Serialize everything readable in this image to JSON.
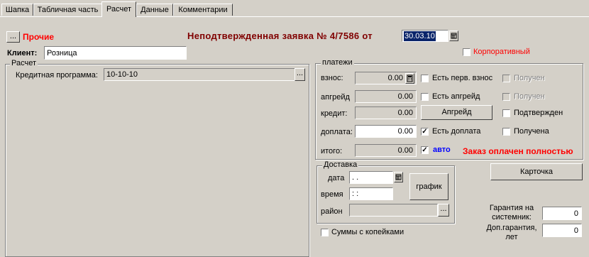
{
  "tabs": [
    "Шапка",
    "Табличная часть",
    "Расчет",
    "Данные",
    "Комментарии"
  ],
  "header": {
    "dots_label": "...",
    "other_label": "Прочие",
    "title": "Неподтвержденная заявка №  4/7586  от",
    "date_value": "30.03.10",
    "client_label": "Клиент:",
    "client_value": "Розница",
    "corporate_label": "Корпоративный"
  },
  "calc": {
    "group_title": "Расчет",
    "credit_label": "Кредитная программа:",
    "credit_value": "10-10-10",
    "ellipsis": "..."
  },
  "payments": {
    "group_title": "платежи",
    "rows": [
      {
        "label": "взнос:",
        "value": "0.00"
      },
      {
        "label": "апгрейд",
        "value": "0.00"
      },
      {
        "label": "кредит:",
        "value": "0.00"
      },
      {
        "label": "доплата:",
        "value": "0.00"
      },
      {
        "label": "итого:",
        "value": "0.00"
      }
    ],
    "first_payment_label": "Есть перв. взнос",
    "upgrade_label": "Есть апгрейд",
    "upgrade_button": "Апгрейд",
    "surcharge_label": "Есть доплата",
    "auto_label": "авто",
    "received1_label": "Получен",
    "received2_label": "Получен",
    "confirmed_label": "Подтвержден",
    "received3_label": "Получена",
    "paid_message": "Заказ оплачен полностью",
    "checks": {
      "first_payment": false,
      "upgrade": false,
      "surcharge": true,
      "auto": true,
      "received1": false,
      "received2": false,
      "confirmed": false,
      "received3": false
    }
  },
  "delivery": {
    "group_title": "Доставка",
    "date_label": "дата",
    "date_value": " .  .",
    "time_label": "время",
    "time_value": " :  :",
    "district_label": "район",
    "schedule_button": "график",
    "kopecks_label": "Суммы с копейками"
  },
  "card_button": "Карточка",
  "warranty": {
    "system_label": "Гарантия на системник:",
    "system_value": "0",
    "extra_label": "Доп.гарантия, лет",
    "extra_value": "0"
  },
  "colors": {
    "title_color": "#800000",
    "red": "#ff0000",
    "blue": "#0000ff",
    "background": "#d4d0c8",
    "selection": "#0a246a"
  }
}
